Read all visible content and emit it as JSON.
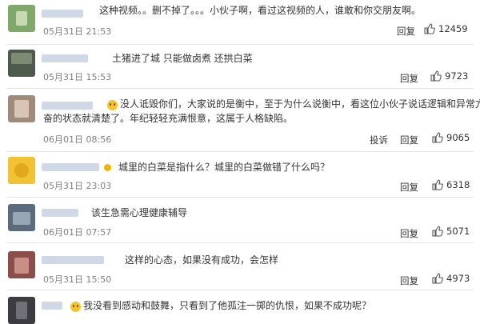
{
  "comments": [
    {
      "text": "这种视频。。删不掉了。。。小伙子啊，看过这视频的人，谁敢和你交朋友啊。",
      "time": "05月31日 21:53",
      "reply": "回复",
      "likes": "12459"
    },
    {
      "text": "土猪进了城 只能做卤煮 还拱白菜",
      "time": "05月31日 15:53",
      "reply": "回复",
      "likes": "9723"
    },
    {
      "text1": "没人诋毁你们，大家说的是衡中，至于为什么说衡中，看这位小伙子说话逻辑和异常亢",
      "text2": "奋的状态就清楚了。年纪轻轻充满恨意，这属于人格缺陷。",
      "time": "06月01日 08:56",
      "report": "投诉",
      "reply": "回复",
      "likes": "9065"
    },
    {
      "text": "城里的白菜是指什么？城里的白菜做错了什么吗？",
      "time": "05月31日 23:03",
      "reply": "回复",
      "likes": "6318"
    },
    {
      "text": "该生急需心理健康辅导",
      "time": "06月01日 07:57",
      "reply": "回复",
      "likes": "5071"
    },
    {
      "text": "这样的心态，如果没有成功，会怎样",
      "time": "05月31日 15:50",
      "reply": "回复",
      "likes": "4973"
    },
    {
      "text": "我没看到感动和鼓舞，只看到了他孤注一掷的仇恨，如果不成功呢？"
    }
  ],
  "icons": {
    "like": "thumbs-up-icon",
    "emoji": "face-emoji-icon",
    "badge": "vip-badge-icon"
  }
}
